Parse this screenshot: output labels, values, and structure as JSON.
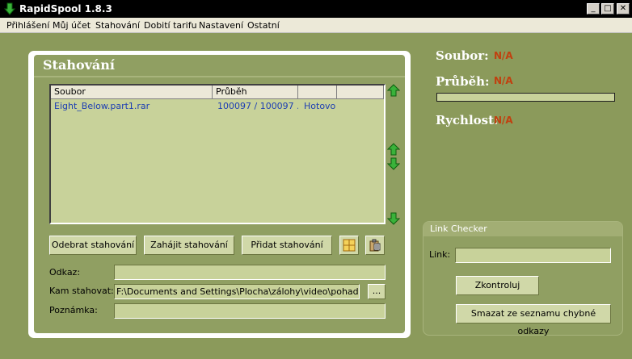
{
  "window": {
    "title": "RapidSpool 1.8.3",
    "controls": {
      "minimize": "_",
      "maximize": "□",
      "close": "✕"
    }
  },
  "menu": [
    "Přihlášení",
    "Můj účet",
    "Stahování",
    "Dobití tarifu",
    "Nastavení",
    "Ostatní"
  ],
  "downloads_panel": {
    "title": "Stahování",
    "columns": [
      "Soubor",
      "Průběh",
      "",
      ""
    ],
    "rows": [
      {
        "file": "Eight_Below.part1.rar",
        "progress": "100097 / 100097 ...",
        "status": "Hotovo"
      }
    ],
    "buttons": {
      "remove": "Odebrat stahování",
      "start": "Zahájit stahování",
      "add": "Přidat stahování"
    },
    "fields": {
      "link_label": "Odkaz:",
      "link_value": "",
      "target_label": "Kam stahovat:",
      "target_value": "F:\\Documents and Settings\\Plocha\\zálohy\\video\\pohadky\\",
      "browse": "...",
      "note_label": "Poznámka:",
      "note_value": ""
    }
  },
  "info": {
    "file_label": "Soubor:",
    "file_value": "N/A",
    "progress_label": "Průběh:",
    "progress_value": "N/A",
    "progress_fraction": 0,
    "speed_label": "Rychlost:",
    "speed_value": "N/A"
  },
  "link_checker": {
    "title": "Link Checker",
    "link_label": "Link:",
    "link_value": "",
    "check_button": "Zkontroluj",
    "clear_button": "Smazat ze seznamu chybné odkazy"
  },
  "icons": {
    "app": "green-down-arrow-icon",
    "up": "green-up-arrow-icon",
    "down": "green-down-arrow-icon",
    "grid": "grid-icon",
    "clipboard": "clipboard-icon"
  },
  "colors": {
    "background": "#8b9a5b",
    "panel": "#909f62",
    "listview": "#c8d29a",
    "list_text": "#1e3fb3",
    "na_value": "#c1400f",
    "titlebar": "#000000"
  }
}
